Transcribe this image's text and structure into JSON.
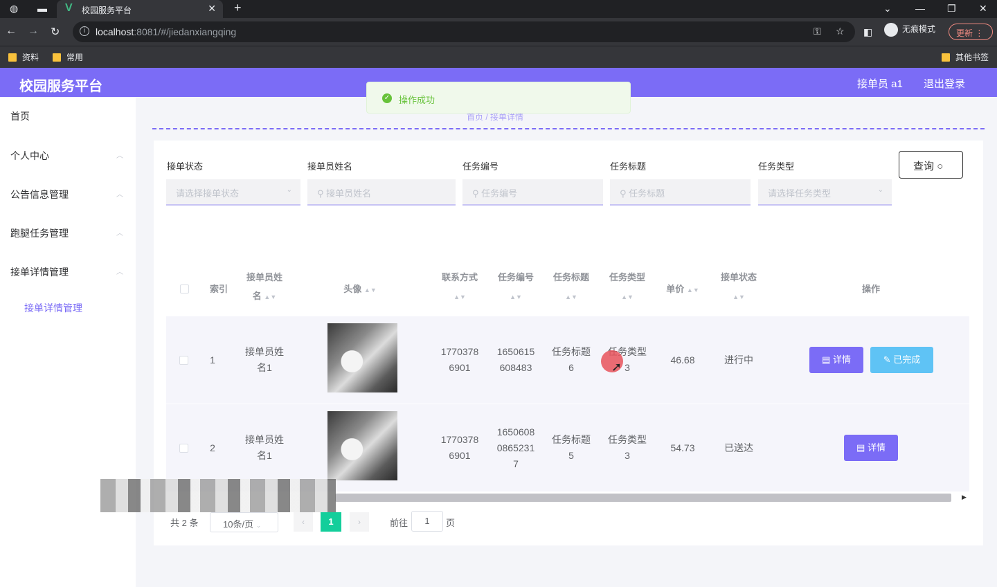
{
  "browser": {
    "tab_title": "校园服务平台",
    "url_host": "localhost",
    "url_rest": ":8081/#/jiedanxiangqing",
    "incognito_label": "无痕模式",
    "update_label": "更新",
    "bookmarks": [
      "资料",
      "常用"
    ],
    "other_bookmarks": "其他书签"
  },
  "app": {
    "brand": "校园服务平台",
    "user": "接单员 a1",
    "logout": "退出登录"
  },
  "toast": {
    "message": "操作成功"
  },
  "breadcrumb": "首页 / 接单详情",
  "sidebar": {
    "items": [
      "首页",
      "个人中心",
      "公告信息管理",
      "跑腿任务管理",
      "接单详情管理"
    ],
    "submenu": "接单详情管理"
  },
  "filters": {
    "labels": [
      "接单状态",
      "接单员姓名",
      "任务编号",
      "任务标题",
      "任务类型"
    ],
    "placeholders": [
      "请选择接单状态",
      "接单员姓名",
      "任务编号",
      "任务标题",
      "请选择任务类型"
    ],
    "query": "查询"
  },
  "table": {
    "headers": {
      "index": "索引",
      "name1": "接单员姓",
      "name2": "名",
      "avatar": "头像",
      "phone": "联系方式",
      "task_no": "任务编号",
      "task_title": "任务标题",
      "task_type": "任务类型",
      "price": "单价",
      "status": "接单状态",
      "ops": "操作"
    },
    "rows": [
      {
        "index": "1",
        "name_a": "接单员姓",
        "name_b": "名1",
        "phone_a": "1770378",
        "phone_b": "6901",
        "no_a": "1650615",
        "no_b": "608483",
        "no_c": "",
        "title_a": "任务标题",
        "title_b": "6",
        "type_a": "任务类型",
        "type_b": "3",
        "price": "46.68",
        "status": "进行中",
        "detail": "详情",
        "done": "已完成"
      },
      {
        "index": "2",
        "name_a": "接单员姓",
        "name_b": "名1",
        "phone_a": "1770378",
        "phone_b": "6901",
        "no_a": "1650608",
        "no_b": "0865231",
        "no_c": "7",
        "title_a": "任务标题",
        "title_b": "5",
        "type_a": "任务类型",
        "type_b": "3",
        "price": "54.73",
        "status": "已送达",
        "detail": "详情"
      }
    ]
  },
  "pagination": {
    "total": "共 2 条",
    "page_size": "10条/页",
    "current": "1",
    "goto": "前往",
    "goto_value": "1",
    "page_suffix": "页"
  }
}
